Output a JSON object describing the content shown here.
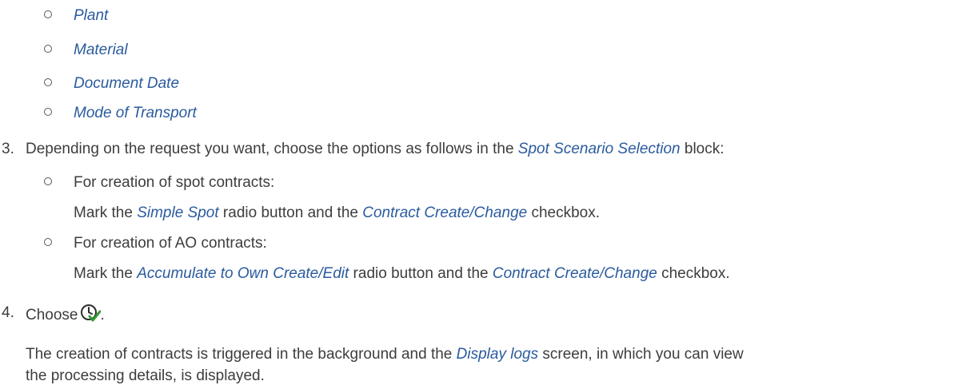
{
  "fields": [
    "Plant",
    "Material",
    "Document Date",
    "Mode of Transport"
  ],
  "step3": {
    "number": "3.",
    "text_before": "Depending on the request you want, choose the options as follows in the ",
    "term": "Spot Scenario Selection",
    "text_after": " block:",
    "options": [
      {
        "heading": "For creation of spot contracts:",
        "mark_prefix": "Mark the ",
        "radio": "Simple Spot",
        "middle": " radio button and the ",
        "checkbox": "Contract Create/Change",
        "suffix": " checkbox."
      },
      {
        "heading": "For creation of AO contracts:",
        "mark_prefix": "Mark the ",
        "radio": "Accumulate to Own Create/Edit",
        "middle": " radio button and the ",
        "checkbox": "Contract Create/Change",
        "suffix": " checkbox."
      }
    ]
  },
  "step4": {
    "number": "4.",
    "text": "Choose",
    "icon": "execute-in-background-icon",
    "period": ".",
    "desc_before": "The creation of contracts is triggered in the background and the ",
    "desc_term": "Display logs",
    "desc_after": " screen, in which you can view",
    "desc_line2": "the processing details, is displayed."
  }
}
